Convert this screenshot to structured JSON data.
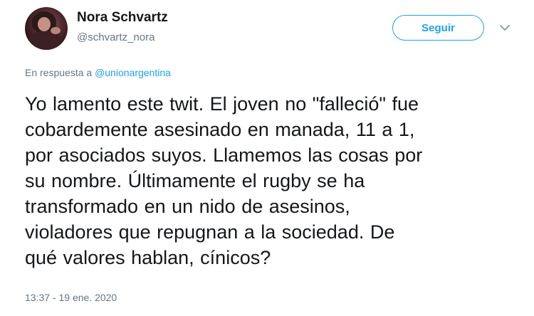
{
  "author": {
    "name": "Nora Schvartz",
    "handle": "@schvartz_nora"
  },
  "follow_button": {
    "label": "Seguir"
  },
  "caret": {
    "icon": "chevron-down-icon"
  },
  "reply_context": {
    "prefix": "En respuesta a ",
    "mention": "@unionargentina"
  },
  "tweet": {
    "lines": [
      "Yo lamento este twit. El joven no \"falleció\" fue",
      "cobardemente asesinado en manada, 11 a 1,",
      "por asociados suyos. Llamemos las cosas por",
      "su nombre. Últimamente el rugby se ha",
      "transformado en un nido de asesinos,",
      "violadores que repugnan a la sociedad. De",
      "qué valores hablan, cínicos?"
    ]
  },
  "timestamp": "13:37 - 19 ene. 2020",
  "colors": {
    "accent": "#1da1f2",
    "secondary_text": "#657786",
    "primary_text": "#14171a"
  }
}
